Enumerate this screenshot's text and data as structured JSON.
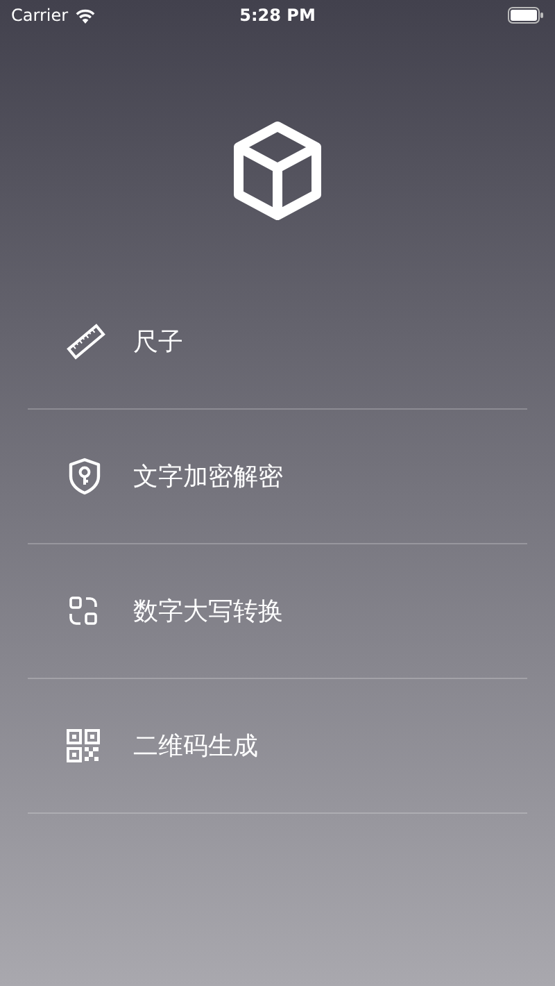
{
  "status_bar": {
    "carrier": "Carrier",
    "time": "5:28 PM"
  },
  "menu": [
    {
      "kind": "ruler",
      "label": "尺子"
    },
    {
      "kind": "shield",
      "label": "文字加密解密"
    },
    {
      "kind": "convert",
      "label": "数字大写转换"
    },
    {
      "kind": "qr",
      "label": "二维码生成"
    }
  ]
}
